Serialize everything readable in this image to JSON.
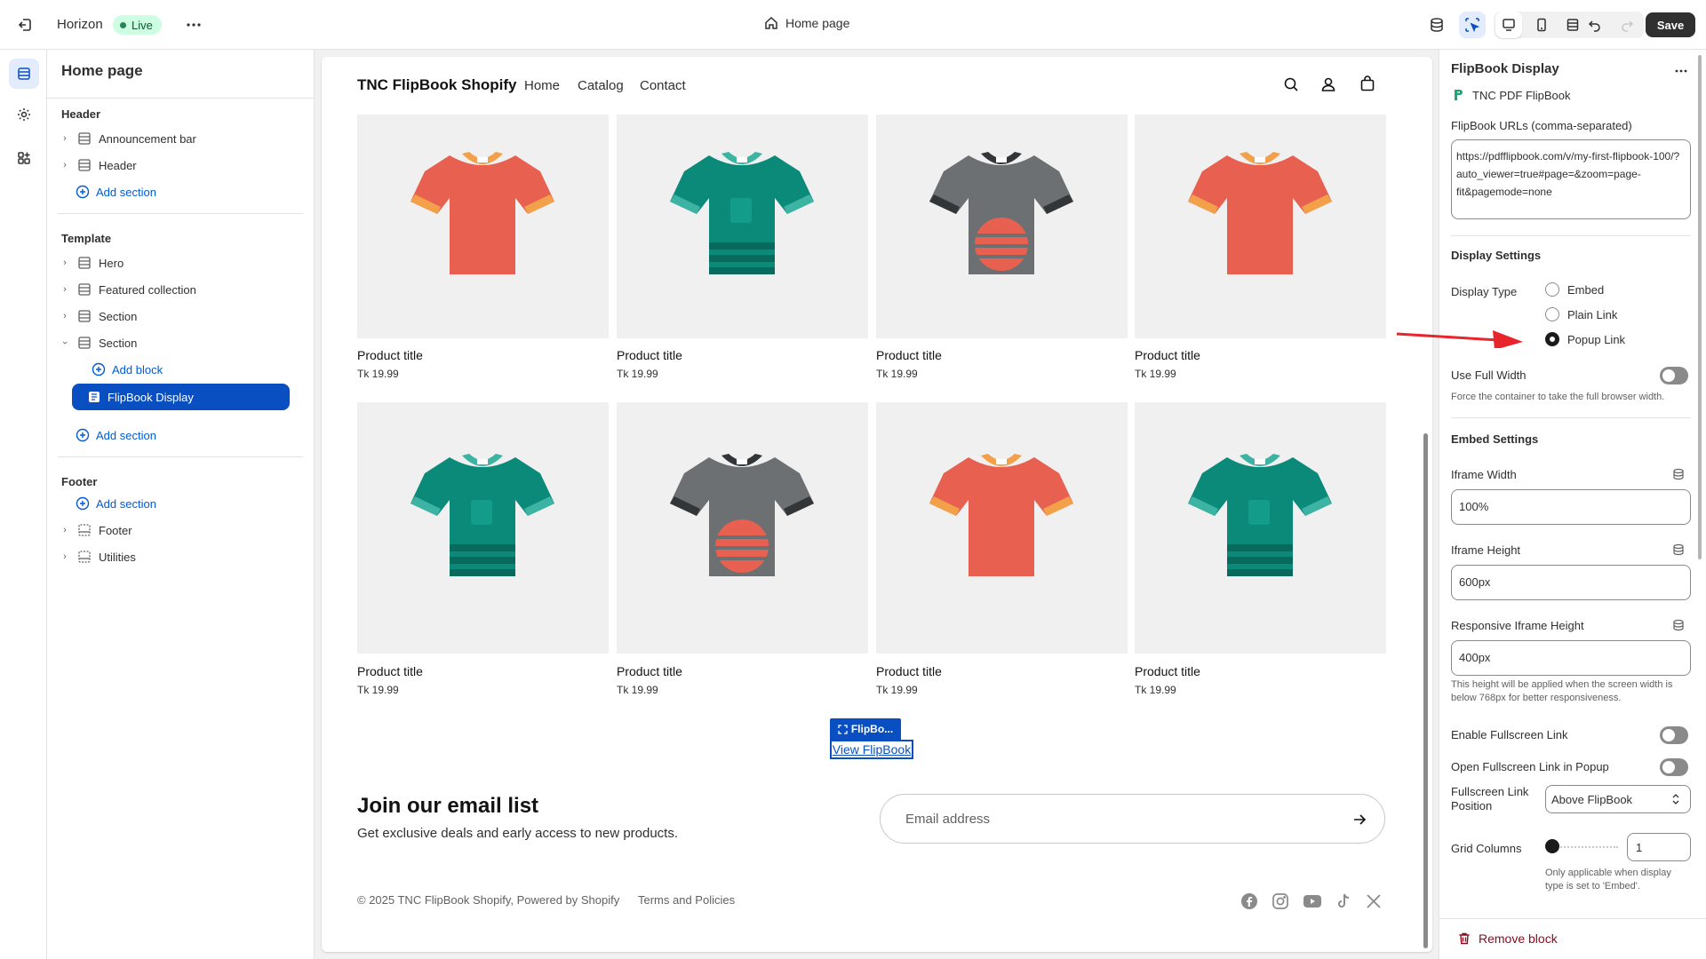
{
  "topbar": {
    "theme_name": "Horizon",
    "status_badge": "Live",
    "page_selector": "Home page",
    "save_label": "Save"
  },
  "sidebar": {
    "title": "Home page",
    "header_group": {
      "title": "Header",
      "items": [
        "Announcement bar",
        "Header"
      ],
      "add_label": "Add section"
    },
    "template_group": {
      "title": "Template",
      "items": [
        "Hero",
        "Featured collection",
        "Section",
        "Section"
      ],
      "add_block_label": "Add block",
      "selected_block": "FlipBook Display",
      "add_label": "Add section"
    },
    "footer_group": {
      "title": "Footer",
      "add_label": "Add section",
      "items": [
        "Footer",
        "Utilities"
      ]
    }
  },
  "preview": {
    "brand": "TNC FlipBook Shopify",
    "nav": [
      "Home",
      "Catalog",
      "Contact"
    ],
    "products": [
      {
        "title": "Product title",
        "price": "Tk 19.99",
        "shirt": "red"
      },
      {
        "title": "Product title",
        "price": "Tk 19.99",
        "shirt": "teal"
      },
      {
        "title": "Product title",
        "price": "Tk 19.99",
        "shirt": "gray"
      },
      {
        "title": "Product title",
        "price": "Tk 19.99",
        "shirt": "red"
      },
      {
        "title": "Product title",
        "price": "Tk 19.99",
        "shirt": "teal"
      },
      {
        "title": "Product title",
        "price": "Tk 19.99",
        "shirt": "gray"
      },
      {
        "title": "Product title",
        "price": "Tk 19.99",
        "shirt": "red"
      },
      {
        "title": "Product title",
        "price": "Tk 19.99",
        "shirt": "teal"
      }
    ],
    "flipbook_tag": "FlipBo...",
    "flipbook_link": "View FlipBook",
    "email_title": "Join our email list",
    "email_subtitle": "Get exclusive deals and early access to new products.",
    "email_placeholder": "Email address",
    "copyright": "© 2025 TNC FlipBook Shopify, Powered by Shopify",
    "policies": "Terms and Policies",
    "social_icons": [
      "facebook-icon",
      "instagram-icon",
      "youtube-icon",
      "tiktok-icon",
      "x-icon"
    ]
  },
  "panel": {
    "title": "FlipBook Display",
    "app_name": "TNC PDF FlipBook",
    "urls_label": "FlipBook URLs (comma-separated)",
    "urls_value": "https://pdfflipbook.com/v/my-first-flipbook-100/?auto_viewer=true#page=&zoom=page-fit&pagemode=none",
    "display_settings_title": "Display Settings",
    "display_type_label": "Display Type",
    "display_type_options": [
      "Embed",
      "Plain Link",
      "Popup Link"
    ],
    "display_type_selected": "Popup Link",
    "full_width_label": "Use Full Width",
    "full_width_help": "Force the container to take the full browser width.",
    "embed_settings_title": "Embed Settings",
    "iframe_width_label": "Iframe Width",
    "iframe_width_value": "100%",
    "iframe_height_label": "Iframe Height",
    "iframe_height_value": "600px",
    "responsive_height_label": "Responsive Iframe Height",
    "responsive_height_value": "400px",
    "responsive_help": "This height will be applied when the screen width is below 768px for better responsiveness.",
    "fullscreen_link_label": "Enable Fullscreen Link",
    "fullscreen_popup_label": "Open Fullscreen Link in Popup",
    "fullscreen_position_label": "Fullscreen Link Position",
    "fullscreen_position_value": "Above FlipBook",
    "grid_columns_label": "Grid Columns",
    "grid_columns_value": "1",
    "grid_help": "Only applicable when display type is set to 'Embed'.",
    "remove_label": "Remove block"
  },
  "colors": {
    "accent": "#0a4fc2",
    "live_bg": "#cdfee1",
    "shirt_red": "#e8604f",
    "shirt_teal": "#0b8a7a",
    "shirt_gray": "#6d7072",
    "annotation_arrow": "#e8252a"
  }
}
